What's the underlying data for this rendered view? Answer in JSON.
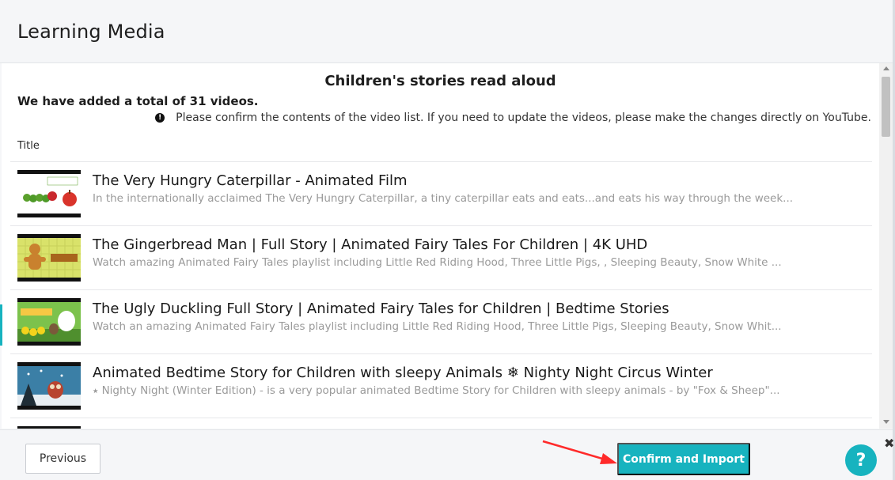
{
  "header": {
    "title": "Learning Media"
  },
  "playlist": {
    "title": "Children's stories read aloud",
    "total_text": "We have added a total of 31 videos.",
    "notice": "Please confirm the contents of the video list. If you need to update the videos, please make the changes directly on YouTube.",
    "info_icon": "!",
    "column_header": "Title"
  },
  "videos": [
    {
      "title": "The Very Hungry Caterpillar - Animated Film",
      "description": "In the internationally acclaimed The Very Hungry Caterpillar, a tiny caterpillar eats and eats...and eats his way through the week..."
    },
    {
      "title": "The Gingerbread Man | Full Story | Animated Fairy Tales For Children | 4K UHD",
      "description": "Watch amazing Animated Fairy Tales playlist including Little Red Riding Hood, Three Little Pigs, , Sleeping Beauty, Snow White ..."
    },
    {
      "title": "The Ugly Duckling Full Story | Animated Fairy Tales for Children | Bedtime Stories",
      "description": "Watch an amazing Animated Fairy Tales playlist including Little Red Riding Hood, Three Little Pigs, Sleeping Beauty, Snow Whit..."
    },
    {
      "title": "Animated Bedtime Story for Children with sleepy Animals ❄ Nighty Night Circus Winter",
      "description": "⭑ Nighty Night (Winter Edition) - is a very popular animated Bedtime Story for Children with sleepy animals - by \"Fox & Sheep\"..."
    }
  ],
  "footer": {
    "previous_label": "Previous",
    "confirm_label": "Confirm and Import",
    "help_label": "?",
    "close_label": "✖"
  },
  "colors": {
    "accent": "#17b3bf",
    "arrow": "#ff2a2a"
  }
}
